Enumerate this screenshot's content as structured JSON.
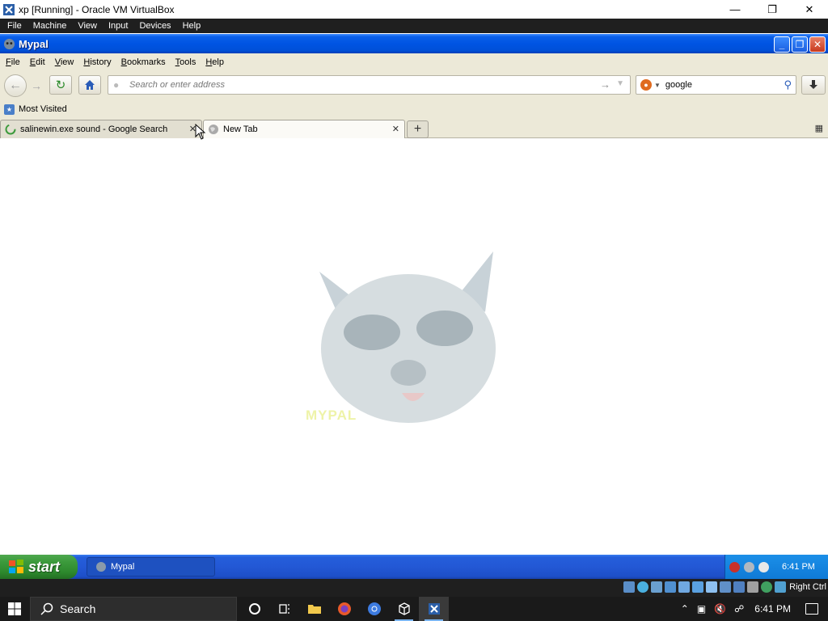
{
  "host": {
    "title": "xp [Running] - Oracle VM VirtualBox",
    "controls": {
      "minimize": "—",
      "restore": "❐",
      "close": "✕"
    },
    "menu": [
      "File",
      "Machine",
      "View",
      "Input",
      "Devices",
      "Help"
    ]
  },
  "xp_window": {
    "title": "Mypal",
    "controls": {
      "minimize": "_",
      "restore": "❐",
      "close": "✕"
    }
  },
  "browser": {
    "menu": [
      {
        "label": "File",
        "access": "F",
        "rest": "ile"
      },
      {
        "label": "Edit",
        "access": "E",
        "rest": "dit"
      },
      {
        "label": "View",
        "access": "V",
        "rest": "iew"
      },
      {
        "label": "History",
        "access": "H",
        "rest": "istory"
      },
      {
        "label": "Bookmarks",
        "access": "B",
        "rest": "ookmarks"
      },
      {
        "label": "Tools",
        "access": "T",
        "rest": "ools"
      },
      {
        "label": "Help",
        "access": "H",
        "rest": "elp"
      }
    ],
    "address_bar": {
      "value": "",
      "placeholder": "Search or enter address"
    },
    "search_bar": {
      "engine": "google",
      "value": "google"
    },
    "bookmarks": [
      {
        "label": "Most Visited"
      }
    ],
    "tabs": [
      {
        "label": "salinewin.exe sound - Google Search",
        "active": false,
        "loading": true
      },
      {
        "label": "New Tab",
        "active": true,
        "loading": false
      }
    ],
    "new_tab_glyph": "+",
    "mascot_caption": "MYPAL"
  },
  "xp_taskbar": {
    "start_label": "start",
    "tasks": [
      {
        "label": "Mypal"
      }
    ],
    "clock": "6:41 PM"
  },
  "vbox_status": {
    "host_key": "Right Ctrl"
  },
  "win_taskbar": {
    "search_placeholder": "Search",
    "clock": "6:41 PM"
  },
  "colors": {
    "xp_title_blue": "#0054e3",
    "xp_start_green": "#3c9a3c",
    "xp_tray_blue": "#0f7ad6",
    "chrome_beige": "#ece9d8",
    "win_taskbar": "#1a1a1a"
  }
}
